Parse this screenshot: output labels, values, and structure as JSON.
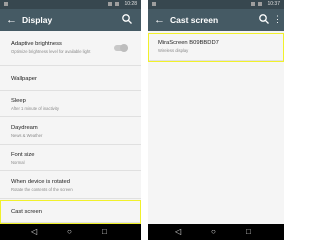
{
  "left_screen": {
    "status": {
      "time": "10:28"
    },
    "title": "Display",
    "items": [
      {
        "title": "Adaptive brightness",
        "sub": "Optimize brightness level for available light"
      },
      {
        "title": "Wallpaper",
        "sub": ""
      },
      {
        "title": "Sleep",
        "sub": "After 1 minute of inactivity"
      },
      {
        "title": "Daydream",
        "sub": "News & Weather"
      },
      {
        "title": "Font size",
        "sub": "Normal"
      },
      {
        "title": "When device is rotated",
        "sub": "Rotate the contents of the screen"
      },
      {
        "title": "Cast screen",
        "sub": ""
      }
    ]
  },
  "right_screen": {
    "status": {
      "time": "10:37"
    },
    "title": "Cast screen",
    "items": [
      {
        "title": "MiraScreen B09BBDD7",
        "sub": "Wireless display"
      }
    ]
  },
  "colors": {
    "accent_highlight": "#f1f12b",
    "actionbar": "#455a64",
    "statusbar": "#37474f"
  },
  "icons": {
    "back": "arrow-left-icon",
    "search": "search-icon",
    "menu": "overflow-menu-icon"
  }
}
